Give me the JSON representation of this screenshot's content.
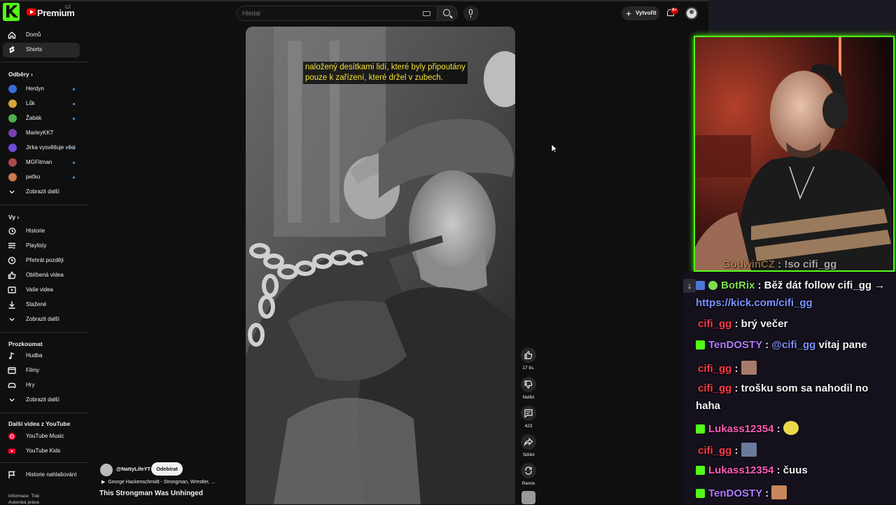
{
  "app": {
    "brand": "Premium",
    "brand_country": "CZ",
    "kick_logo": "K"
  },
  "search": {
    "placeholder": "Hledat"
  },
  "header": {
    "create_label": "Vytvořit",
    "notifications_badge": "9+"
  },
  "sidebar": {
    "home": "Domů",
    "shorts": "Shorts",
    "subscriptions_heading": "Odběry",
    "channels": [
      {
        "name": "Herdyn",
        "color": "#3b6bd6",
        "new": true
      },
      {
        "name": "Lůk",
        "color": "#d9a43b",
        "new": true
      },
      {
        "name": "Žabák",
        "color": "#4caf50",
        "new": true
      },
      {
        "name": "MarleyKKT",
        "color": "#7a3fb0",
        "new": false
      },
      {
        "name": "Jirka vysvětluje věci",
        "color": "#6d4bd9",
        "new": true
      },
      {
        "name": "MGFitman",
        "color": "#b04a4a",
        "new": true
      },
      {
        "name": "peťko",
        "color": "#c97a4a",
        "new": true
      }
    ],
    "show_more": "Zobrazit další",
    "you_heading": "Vy",
    "you_items": [
      "Historie",
      "Playlisty",
      "Přehrát později",
      "Oblíbená videa",
      "Vaše videa",
      "Stažené",
      "Zobrazit další"
    ],
    "explore_heading": "Prozkoumat",
    "explore_items": [
      "Hudba",
      "Filmy",
      "Hry",
      "Zobrazit další"
    ],
    "more_heading": "Další videa z YouTube",
    "more_items": [
      "YouTube Music",
      "YouTube Kids"
    ],
    "report_history": "Historie nahlašování",
    "footer_1": "Informace  Tisk",
    "footer_2": "Autorská práva"
  },
  "short": {
    "caption_line1": "naložený desítkami lidí, které byly připoutány",
    "caption_line2": "pouze k zařízení, které držel v zubech.",
    "likes": "17 tis.",
    "dislike_label": "Nelíbí",
    "comments": "423",
    "share_label": "Sdílet",
    "remix_label": "Remix",
    "channel": "@NattyLifeYT",
    "subscribe_label": "Odebírat",
    "music": "George Hackenschmidt - Strongman, Wrestler, ...",
    "title": "This Strongman Was Unhinged"
  },
  "chat": [
    {
      "user": "GodwinCZ",
      "text": ": !so cifi_gg",
      "user_color": "#c58a52"
    },
    {
      "user": "BotRix",
      "text": ": Běž dát follow cifi_gg →",
      "user_color": "#7ddf4b"
    },
    {
      "link": "https://kick.com/cifi_gg"
    },
    {
      "user": "cifi_gg",
      "text": ": brý večer",
      "user_color": "#ff3b46"
    },
    {
      "user": "TenDOSTY",
      "mention": "@cifi_gg",
      "text": " vítaj pane",
      "user_color": "#b07bff"
    },
    {
      "user": "cifi_gg",
      "text": ":",
      "user_color": "#ff3b46"
    },
    {
      "user": "cifi_gg",
      "text": ": trošku som sa nahodil no",
      "user_color": "#ff3b46"
    },
    {
      "text_cont": "haha"
    },
    {
      "user": "Lukass12354",
      "text": ":",
      "user_color": "#ff5db8"
    },
    {
      "user": "cifi_gg",
      "text": ":",
      "user_color": "#ff3b46"
    },
    {
      "user": "Lukass12354",
      "text": ": čuus",
      "user_color": "#ff5db8"
    },
    {
      "user": "TenDOSTY",
      "text": ":",
      "user_color": "#b07bff"
    }
  ],
  "colors": {
    "kick_green": "#53fc18",
    "yt_red": "#ff0000",
    "bg": "#0f0f0f"
  }
}
